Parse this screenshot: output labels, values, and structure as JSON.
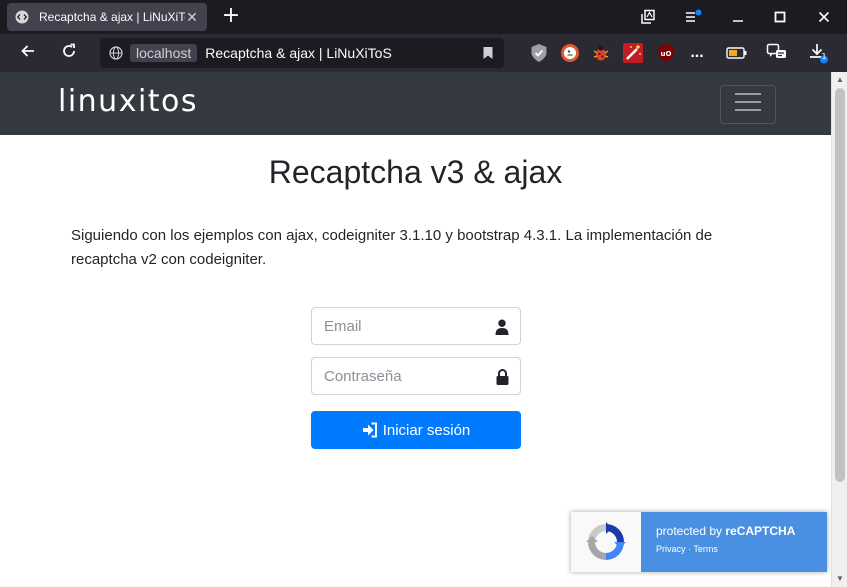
{
  "browser": {
    "tab": {
      "title": "Recaptcha & ajax | LiNuXiToS"
    },
    "new_tab_symbol": "+",
    "urlbar": {
      "host": "localhost",
      "title": "Recaptcha & ajax | LiNuXiToS"
    },
    "more_label": "...",
    "downloads_badge": "1",
    "icons": {
      "tab_favicon": "code-icon",
      "tab_close": "close-icon",
      "back": "arrow-left-icon",
      "reload": "reload-icon",
      "site_info": "globe-icon",
      "bookmark": "bookmark-icon",
      "extensions": [
        "shield-icon",
        "duckduckgo-icon",
        "bug-icon",
        "magic-wand-icon",
        "ublock-icon",
        "more-icon",
        "battery-icon",
        "chat-icon",
        "download-icon"
      ],
      "window": [
        "collections-icon",
        "tab-list-icon",
        "minimize-icon",
        "maximize-icon",
        "close-window-icon"
      ]
    }
  },
  "site": {
    "logo": "linuxitos",
    "heading": "Recaptcha v3 & ajax",
    "intro": "Siguiendo con los ejemplos con ajax, codeigniter 3.1.10 y bootstrap 4.3.1. La implementación de recaptcha v2 con codeigniter.",
    "form": {
      "email_placeholder": "Email",
      "password_placeholder": "Contraseña",
      "submit_label": "Iniciar sesión"
    },
    "recaptcha": {
      "protected_prefix": "protected by ",
      "protected_brand": "reCAPTCHA",
      "privacy": "Privacy",
      "separator": " · ",
      "terms": "Terms"
    }
  },
  "colors": {
    "header_bg": "#343a40",
    "primary": "#007bff",
    "recaptcha_blue": "#4a90e2"
  }
}
